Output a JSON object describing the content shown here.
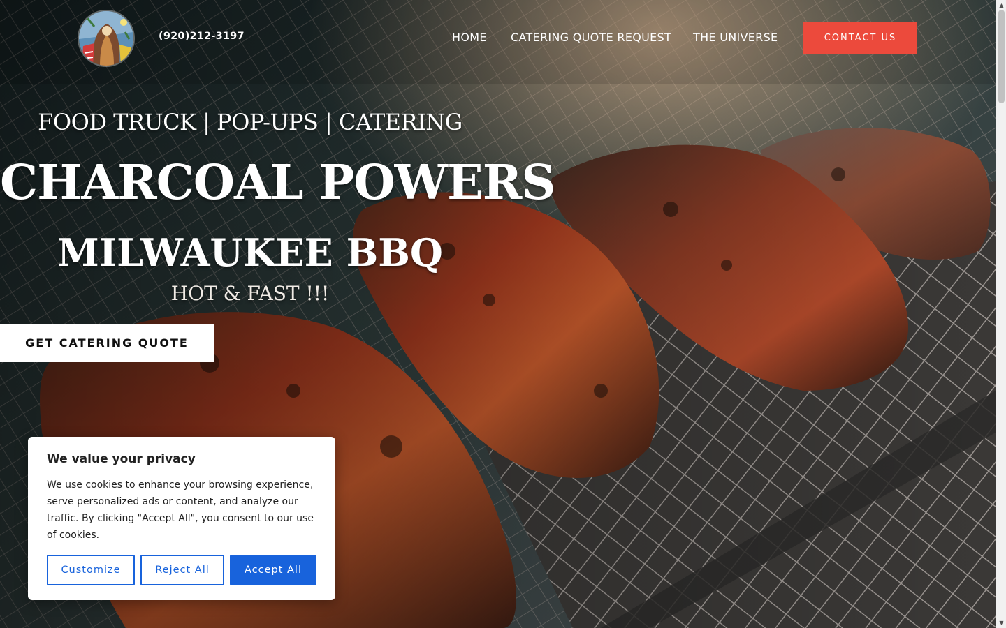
{
  "header": {
    "phone": "(920)212-3197",
    "nav": {
      "home": "HOME",
      "catering_quote_request": "CATERING QUOTE REQUEST",
      "universe": "THE UNIVERSE"
    },
    "contact_button": "CONTACT US",
    "logo_icon": "illustrated-portrait-logo"
  },
  "hero": {
    "tagline": "FOOD TRUCK | POP-UPS | CATERING",
    "brand": "CHARCOAL POWERS",
    "subbrand": "MILWAUKEE BBQ",
    "slogan": "HOT & FAST !!!",
    "cta_button": "GET CATERING QUOTE",
    "background": "bbq-ribs-on-grill-photo"
  },
  "cookie_banner": {
    "title": "We value your privacy",
    "text": "We use cookies to enhance your browsing experience, serve personalized ads or content, and analyze our traffic. By clicking \"Accept All\", you consent to our use of cookies.",
    "customize": "Customize",
    "reject_all": "Reject All",
    "accept_all": "Accept All"
  },
  "colors": {
    "accent": "#ec4a3c",
    "cookie_blue": "#1863dc"
  }
}
